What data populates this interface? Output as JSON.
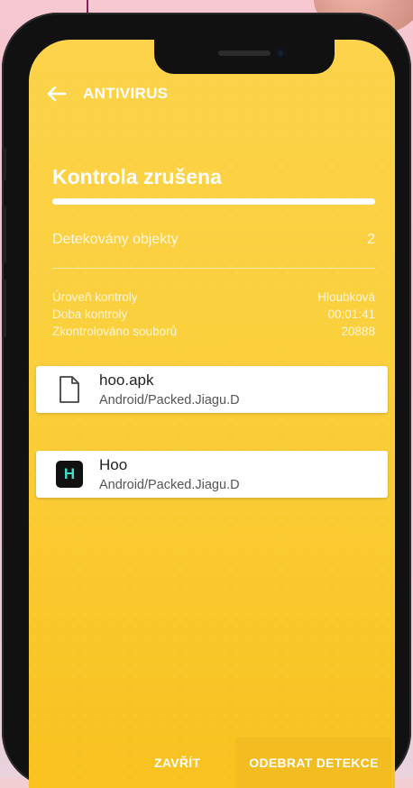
{
  "header": {
    "title": "ANTIVIRUS",
    "back_icon": "arrow-left-icon"
  },
  "scan": {
    "status": "Kontrola zrušena",
    "progress": 1.0,
    "detected_label": "Detekovány objekty",
    "detected_count": "2",
    "stats": [
      {
        "label": "Úroveň kontroly",
        "value": "Hloubková"
      },
      {
        "label": "Doba kontroly",
        "value": "00:01:41"
      },
      {
        "label": "Zkontrolováno souborů",
        "value": "20888"
      }
    ]
  },
  "detections": [
    {
      "name": "hoo.apk",
      "detection": "Android/Packed.Jiagu.D",
      "icon": "file-icon"
    },
    {
      "name": "Hoo",
      "detection": "Android/Packed.Jiagu.D",
      "icon": "app-icon",
      "icon_letter": "H"
    }
  ],
  "actions": {
    "close_label": "ZAVŘÍT",
    "remove_label": "ODEBRAT DETEKCE"
  },
  "colors": {
    "accent": "#fbcf3b",
    "app_icon_letter": "#3fe0c8"
  }
}
